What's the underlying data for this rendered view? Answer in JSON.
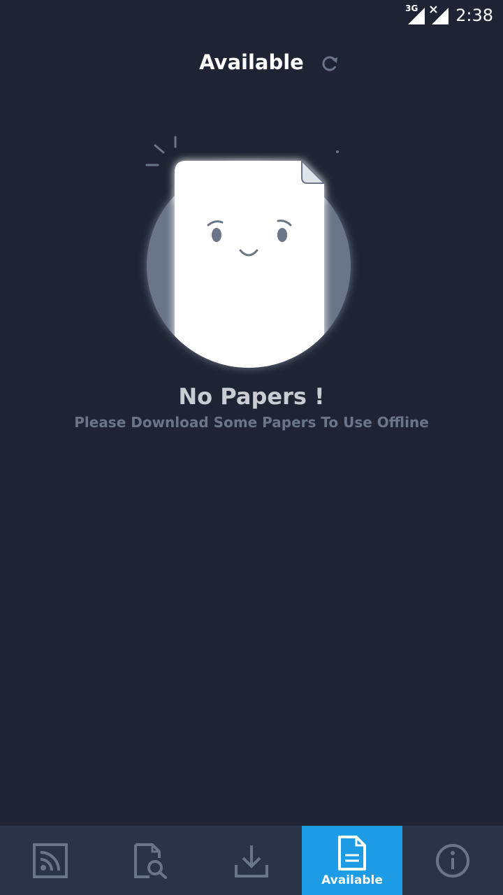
{
  "status_bar": {
    "network_label": "3G",
    "time": "2:38"
  },
  "header": {
    "title": "Available",
    "refresh_icon": "refresh-icon"
  },
  "empty_state": {
    "title": "No Papers !",
    "subtitle": "Please Download Some Papers To Use Offline",
    "illustration": "sad-document-illustration"
  },
  "bottom_nav": {
    "items": [
      {
        "icon": "feed-icon",
        "label": ""
      },
      {
        "icon": "search-paper-icon",
        "label": ""
      },
      {
        "icon": "download-icon",
        "label": ""
      },
      {
        "icon": "document-icon",
        "label": "Available",
        "active": true
      },
      {
        "icon": "info-icon",
        "label": ""
      }
    ]
  },
  "colors": {
    "background": "#1e2433",
    "nav_background": "#2b3446",
    "accent": "#1e9be5",
    "icon_muted": "#6b7588"
  }
}
